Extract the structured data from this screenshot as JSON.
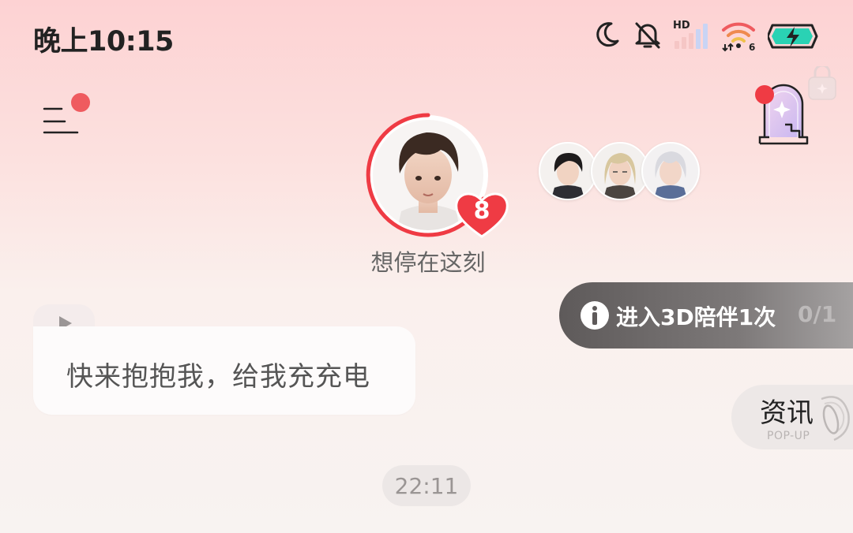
{
  "status_bar": {
    "time": "晚上10:15",
    "icons": [
      "moon-icon",
      "bell-off-icon",
      "hd-signal-icon",
      "wifi-6-icon",
      "battery-charging-icon"
    ],
    "hd_label": "HD",
    "wifi_label": "6"
  },
  "header": {
    "menu_icon": "menu-icon",
    "menu_has_badge": true,
    "scene_icon": "sparkle-doorway-icon",
    "scene_locked": true
  },
  "character": {
    "status_text": "想停在这刻",
    "affection_level": "8",
    "affection_ring_fraction": 0.72,
    "others_count": 3
  },
  "task": {
    "label": "进入3D陪伴1次",
    "progress": "0/1"
  },
  "news": {
    "title": "资讯",
    "subtitle": "POP-UP"
  },
  "message": {
    "text": "快来抱抱我，给我充充电",
    "has_voice": true
  },
  "timestamp": "22:11",
  "colors": {
    "accent": "#ef3b44",
    "badge": "#ef5b5f"
  }
}
